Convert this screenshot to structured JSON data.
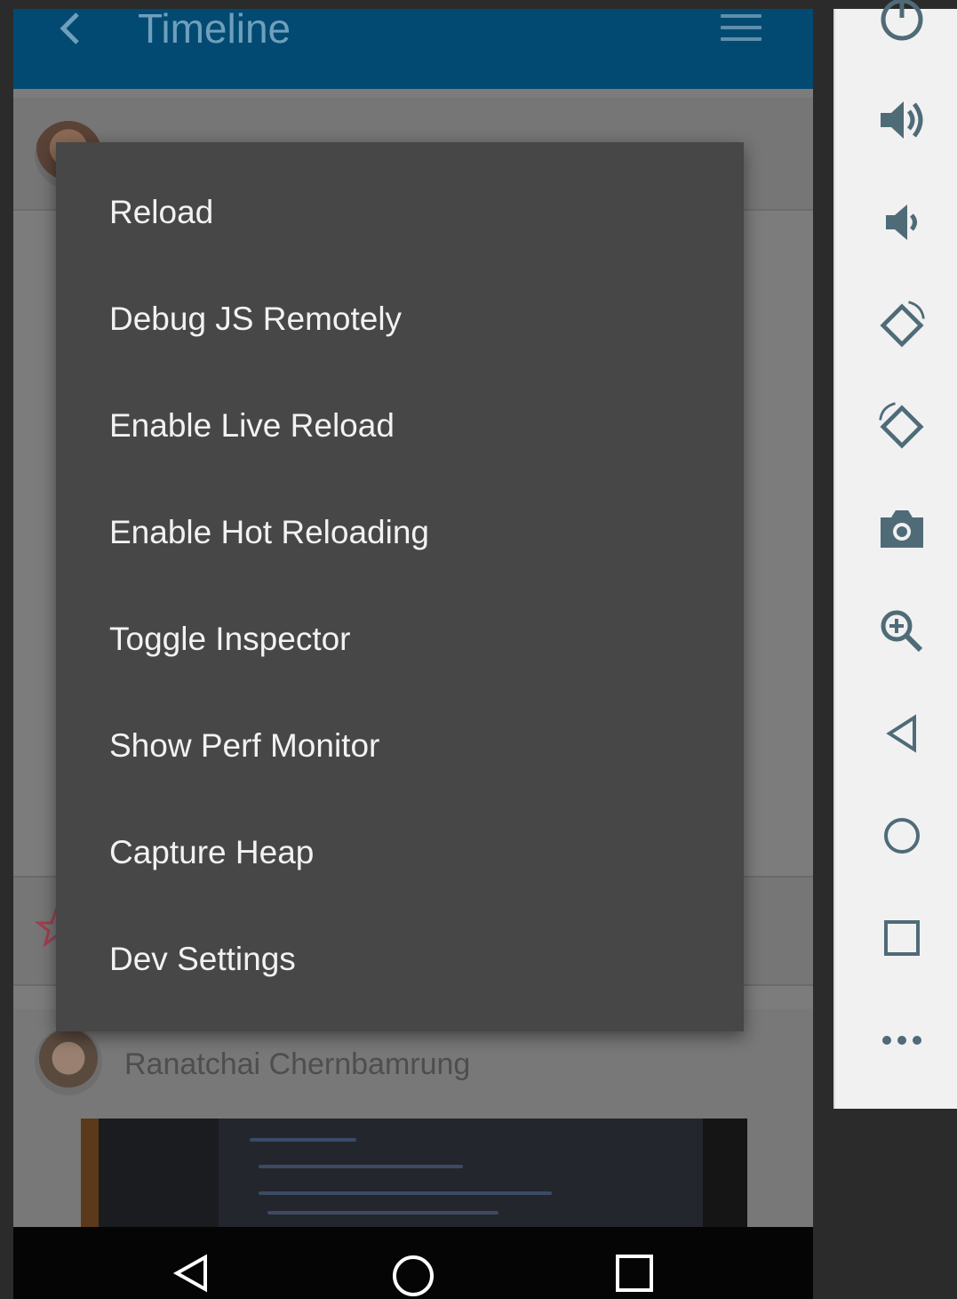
{
  "app_bar": {
    "title": "Timeline",
    "back_icon": "chevron-left-icon",
    "menu_icon": "hamburger-icon"
  },
  "feed": {
    "second_post_author": "Ranatchai Chernbamrung"
  },
  "dev_menu": {
    "items": [
      {
        "label": "Reload"
      },
      {
        "label": "Debug JS Remotely"
      },
      {
        "label": "Enable Live Reload"
      },
      {
        "label": "Enable Hot Reloading"
      },
      {
        "label": "Toggle Inspector"
      },
      {
        "label": "Show Perf Monitor"
      },
      {
        "label": "Capture Heap"
      },
      {
        "label": "Dev Settings"
      }
    ]
  },
  "system_nav": {
    "icons": [
      "back-icon",
      "home-icon",
      "recents-icon"
    ]
  },
  "emulator_toolbar": {
    "icons": [
      "power-icon",
      "volume-up-icon",
      "volume-down-icon",
      "rotate-left-icon",
      "rotate-right-icon",
      "camera-icon",
      "zoom-icon",
      "back-icon",
      "home-icon",
      "overview-icon",
      "more-icon"
    ]
  },
  "colors": {
    "app_bar": "#024a71",
    "menu_background": "#474747",
    "menu_text": "#f2f2f2",
    "toolbar_background": "#f1f1f1",
    "toolbar_icon": "#4f6b78"
  }
}
